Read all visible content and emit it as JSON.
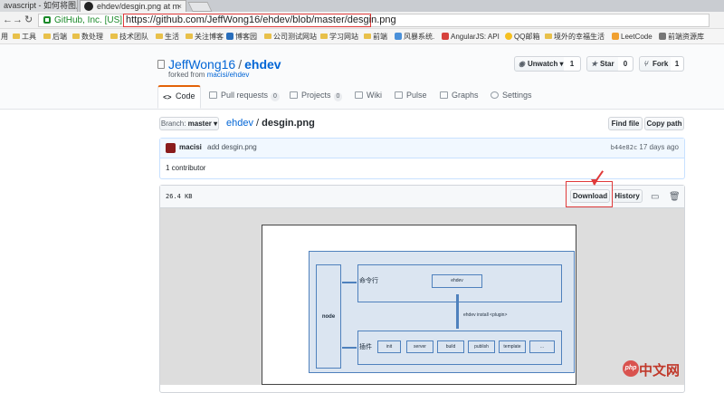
{
  "browser": {
    "tabs": [
      {
        "title": "avascript - 如何将图片"
      },
      {
        "title": "ehdev/desgin.png at m"
      }
    ],
    "security_label": "GitHub, Inc. [US]",
    "url": "https://github.com/JeffWong16/ehdev/blob/master/desgin.png",
    "bookmarks": [
      "用",
      "工具",
      "后端",
      "数处理",
      "技术团队",
      "生活",
      "关注博客",
      "博客园",
      "公司测试网站",
      "学习网站",
      "前端",
      "风暴系统.",
      "AngularJS: API",
      "QQ邮箱",
      "境外的幸福生活",
      "LeetCode",
      "前端资源库"
    ]
  },
  "repo": {
    "owner": "JeffWong16",
    "separator": "/",
    "name": "ehdev",
    "forked_prefix": "forked from ",
    "forked_from": "macisi/ehdev",
    "unwatch_label": "Unwatch ▾",
    "watch_count": "1",
    "star_label": "Star",
    "star_count": "0",
    "fork_label": "Fork",
    "fork_count": "1"
  },
  "tabs": {
    "code": "Code",
    "pulls": "Pull requests",
    "pulls_count": "0",
    "projects": "Projects",
    "projects_count": "0",
    "wiki": "Wiki",
    "pulse": "Pulse",
    "graphs": "Graphs",
    "settings": "Settings"
  },
  "file_nav": {
    "branch_prefix": "Branch: ",
    "branch": "master ▾",
    "path_repo": "ehdev",
    "path_sep": " / ",
    "path_file": "desgin.png",
    "find_file": "Find file",
    "copy_path": "Copy path"
  },
  "commit": {
    "author": "macisi",
    "message": "add desgin.png",
    "sha": "b44e82c",
    "time": "17 days ago",
    "contributors": "1 contributor"
  },
  "file": {
    "size": "26.4 KB",
    "download": "Download",
    "history": "History"
  },
  "diagram": {
    "node": "node",
    "cli": "命令行",
    "core": "ehdev",
    "install": "ehdev install <plugin>",
    "plugins_label": "插件",
    "plugins": [
      "init",
      "server",
      "build",
      "publish",
      "template",
      "..."
    ]
  },
  "watermark": {
    "logo": "php",
    "text": "中文网"
  },
  "colors": {
    "link": "#0366d6",
    "annotation_red": "#e03a3a",
    "diagram_blue": "#4f81bd",
    "diagram_fill": "#dbe5f1",
    "tab_accent": "#e36209"
  }
}
